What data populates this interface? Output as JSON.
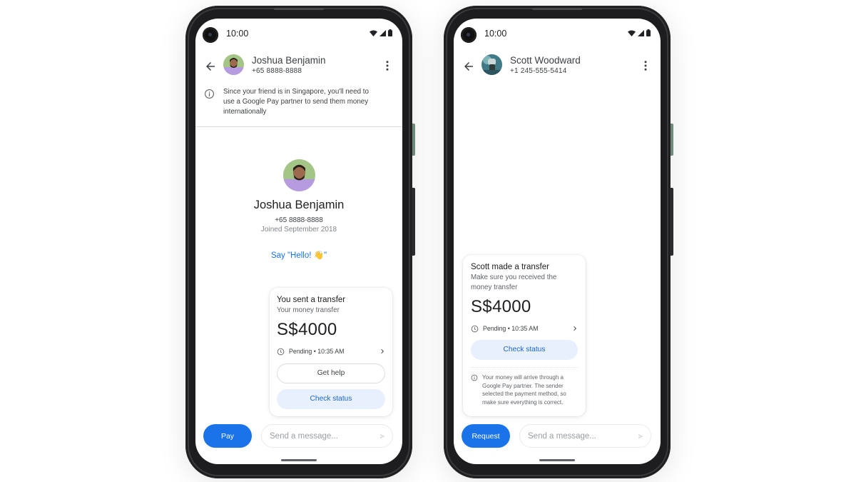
{
  "colors": {
    "accent": "#1a73e8",
    "tonal_bg": "#e8f0fe",
    "tonal_text": "#1967d2",
    "phone_frame": "#1d1d1f"
  },
  "phones": [
    {
      "status_bar": {
        "time": "10:00",
        "icons": [
          "wifi-icon",
          "signal-icon",
          "battery-icon"
        ]
      },
      "app_bar": {
        "back_icon": "arrow-back-icon",
        "contact_name": "Joshua Benjamin",
        "contact_phone": "+65 8888-8888",
        "menu_icon": "more-vert-icon"
      },
      "info_banner": {
        "icon": "info-icon",
        "text": "Since your friend is in Singapore, you'll need to use a Google Pay partner to send them money internationally"
      },
      "profile": {
        "name": "Joshua Benjamin",
        "phone": "+65 8888-8888",
        "joined": "Joined September 2018",
        "greeting": "Say \"Hello! 👋\""
      },
      "transfer_card": {
        "title": "You sent a transfer",
        "subtitle": "Your money transfer",
        "amount": "S$4000",
        "status": "Pending • 10:35 AM",
        "status_icon": "clock-icon",
        "secondary_button": "Get help",
        "primary_button": "Check status"
      },
      "bottom_bar": {
        "action_button": "Pay",
        "message_placeholder": "Send a message...",
        "send_icon": "send-icon"
      }
    },
    {
      "status_bar": {
        "time": "10:00",
        "icons": [
          "wifi-icon",
          "signal-icon",
          "battery-icon"
        ]
      },
      "app_bar": {
        "back_icon": "arrow-back-icon",
        "contact_name": "Scott Woodward",
        "contact_phone": "+1 245-555-5414",
        "menu_icon": "more-vert-icon"
      },
      "transfer_card": {
        "title": "Scott made a transfer",
        "subtitle": "Make sure you received the money transfer",
        "amount": "S$4000",
        "status": "Pending • 10:35 AM",
        "status_icon": "clock-icon",
        "primary_button": "Check status",
        "note_icon": "info-icon",
        "note": "Your money will arrive through a Google Pay partner. The sender selected the payment method, so make sure everything is correct."
      },
      "bottom_bar": {
        "action_button": "Request",
        "message_placeholder": "Send a message...",
        "send_icon": "send-icon"
      }
    }
  ]
}
